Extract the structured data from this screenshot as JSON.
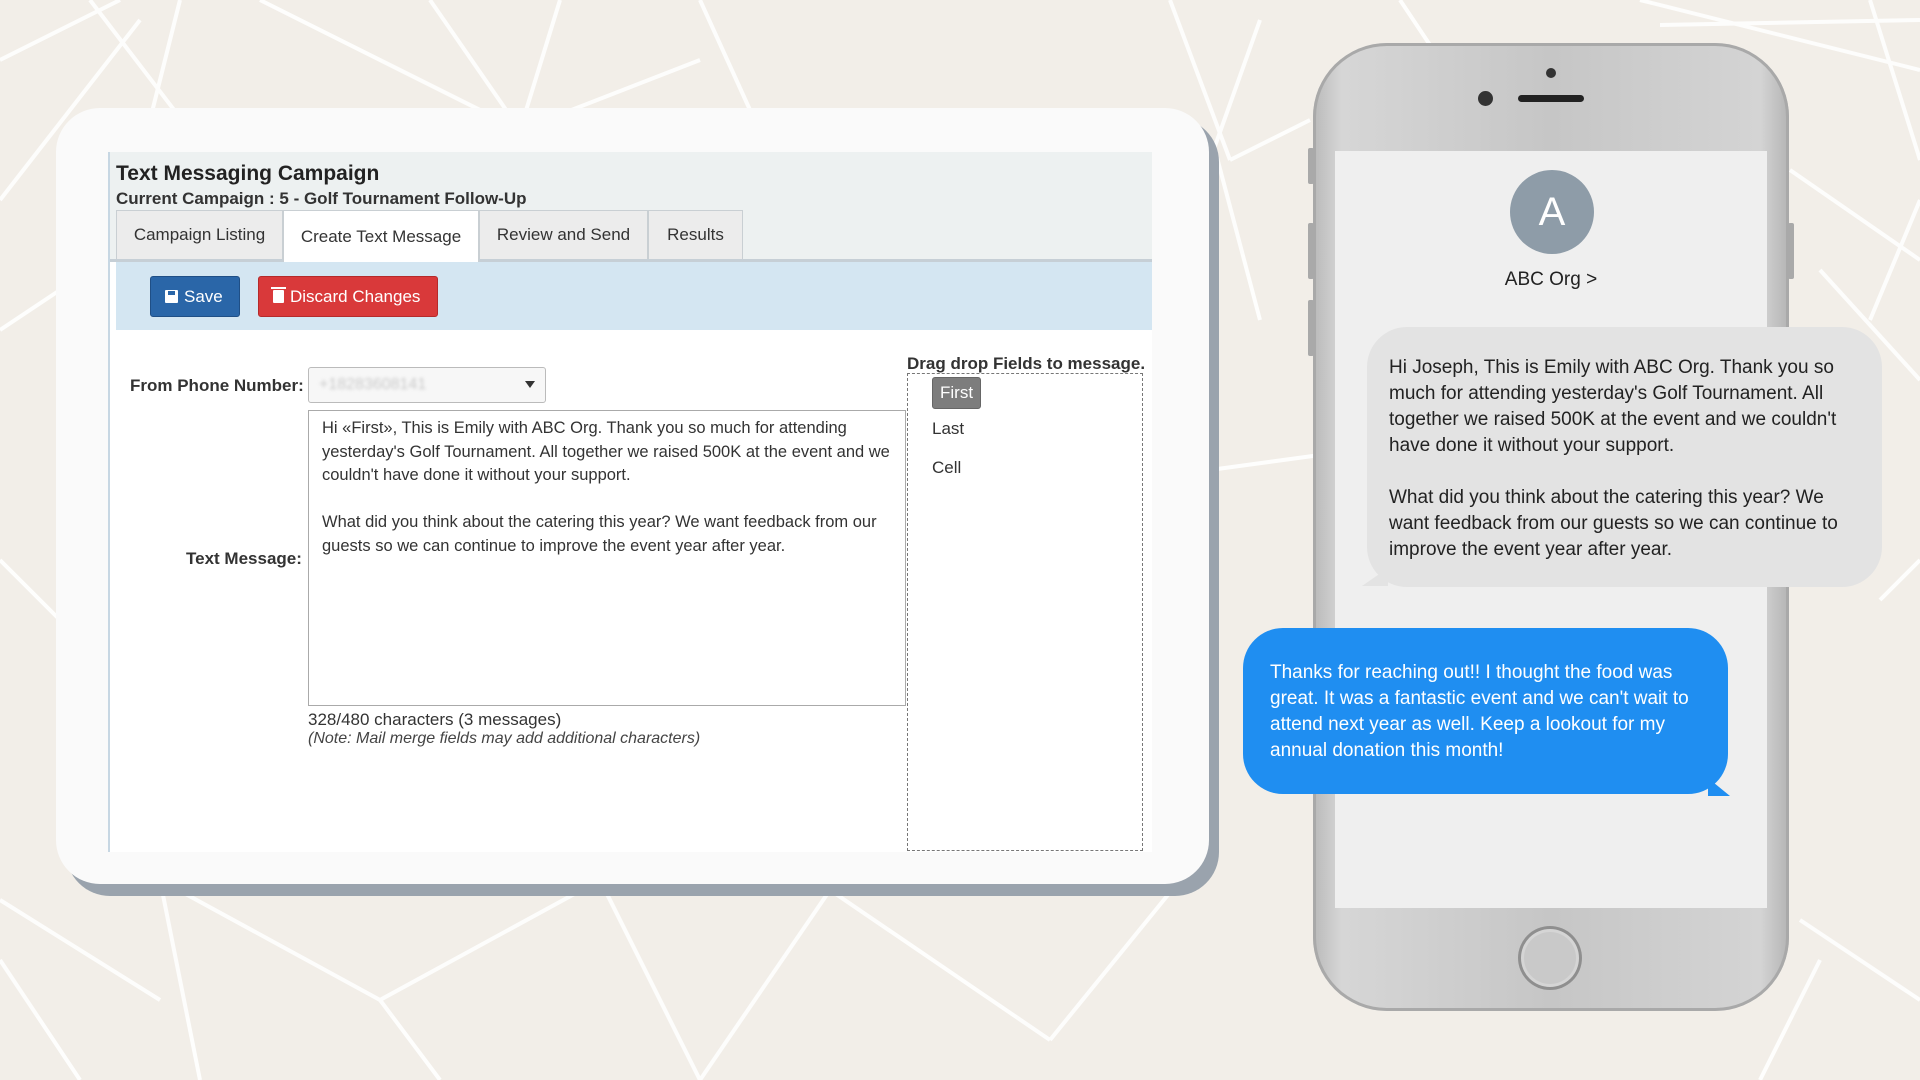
{
  "app": {
    "title": "Text Messaging Campaign",
    "current_campaign": "Current Campaign : 5 - Golf Tournament Follow-Up",
    "tabs": [
      {
        "label": "Campaign Listing"
      },
      {
        "label": "Create Text Message"
      },
      {
        "label": "Review and Send"
      },
      {
        "label": "Results"
      }
    ],
    "toolbar": {
      "save_label": "Save",
      "discard_label": "Discard Changes"
    },
    "form": {
      "from_phone_label": "From Phone Number:",
      "from_phone_value": "+18283608141",
      "text_message_label": "Text Message:",
      "text_message_value": "Hi «First», This is Emily with ABC Org. Thank you so much for attending yesterday's Golf Tournament. All together we raised 500K at the event and we couldn't have done it without your support.\n\nWhat did you think about the catering this year? We want feedback from our guests so we can continue to improve the event year after year.",
      "char_count": "328/480 characters (3 messages)",
      "note": "(Note: Mail merge fields may add additional characters)"
    },
    "drag_fields": {
      "label": "Drag drop Fields to message.",
      "items": [
        "First",
        "Last",
        "Cell"
      ]
    },
    "colors": {
      "save": "#2a66a8",
      "discard": "#d9393a",
      "toolbar_bg": "#d4e6f2"
    }
  },
  "phone": {
    "avatar_letter": "A",
    "contact_name": "ABC Org >",
    "incoming_message": "Hi Joseph, This is Emily with ABC Org. Thank you so much for attending yesterday's Golf Tournament. All together we raised 500K at the event and we couldn't have done it without your support.\n\nWhat did you think about the catering this year? We want feedback from our guests so we can continue to improve the event year after year.",
    "outgoing_message": "Thanks for reaching out!! I thought the food was great. It was a fantastic event and we can't wait to attend next year as well. Keep a lookout for my annual donation this month!",
    "colors": {
      "incoming_bubble": "#e3e3e3",
      "outgoing_bubble": "#1f8ef1"
    }
  }
}
